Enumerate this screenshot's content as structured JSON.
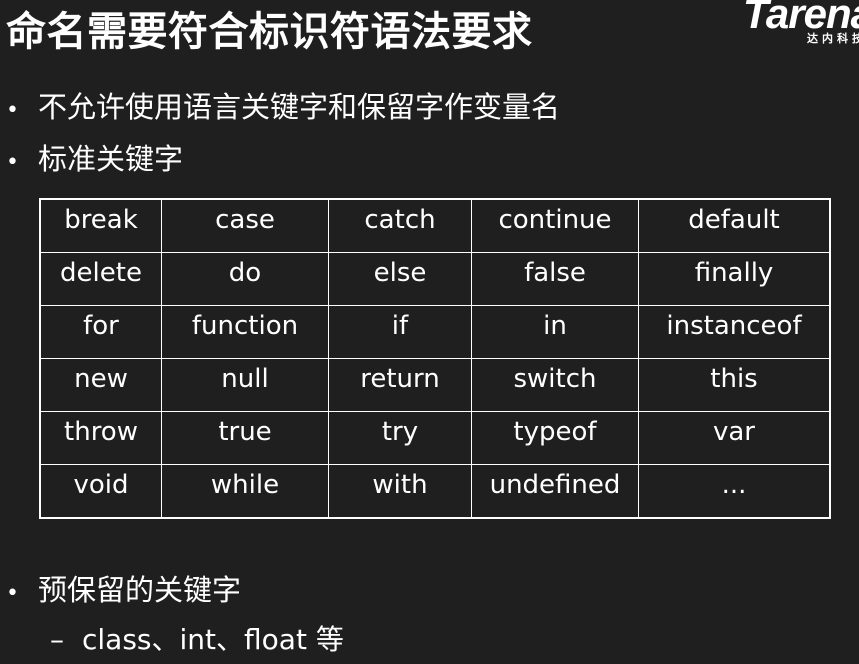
{
  "slide": {
    "title": "命名需要符合标识符语法要求"
  },
  "logo": {
    "wordmark": "Tarena",
    "subtitle": "达内科技"
  },
  "bullets": [
    {
      "marker": "•",
      "text": "不允许使用语言关键字和保留字作变量名"
    },
    {
      "marker": "•",
      "text": "标准关键字"
    }
  ],
  "keywords_table": {
    "rows": [
      [
        "break",
        "case",
        "catch",
        "continue",
        "default"
      ],
      [
        "delete",
        "do",
        "else",
        "false",
        "finally"
      ],
      [
        "for",
        "function",
        "if",
        "in",
        "instanceof"
      ],
      [
        "new",
        "null",
        "return",
        "switch",
        "this"
      ],
      [
        "throw",
        "true",
        "try",
        "typeof",
        "var"
      ],
      [
        "void",
        "while",
        "with",
        "undefined",
        "..."
      ]
    ]
  },
  "reserved": {
    "marker": "•",
    "text": "预保留的关键字",
    "sub_marker": "–",
    "sub_text": "class、int、float 等"
  }
}
